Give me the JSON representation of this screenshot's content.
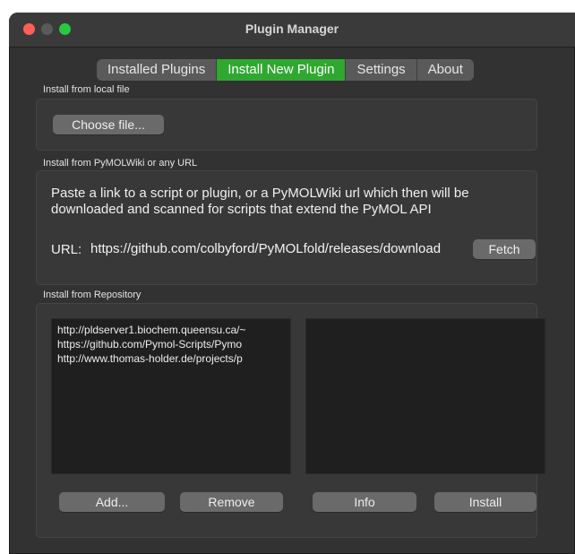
{
  "window": {
    "title": "Plugin Manager"
  },
  "tabs": [
    {
      "label": "Installed Plugins",
      "active": false
    },
    {
      "label": "Install New Plugin",
      "active": true
    },
    {
      "label": "Settings",
      "active": false
    },
    {
      "label": "About",
      "active": false
    }
  ],
  "local_file": {
    "label": "Install from local file",
    "choose_button": "Choose file..."
  },
  "url_section": {
    "label": "Install from PyMOLWiki or any URL",
    "description": "Paste a link to a script or plugin, or a PyMOLWiki url which then will be downloaded and scanned for scripts that extend the PyMOL API",
    "url_label": "URL:",
    "url_value": "https://github.com/colbyford/PyMOLfold/releases/download",
    "fetch_button": "Fetch"
  },
  "repository": {
    "label": "Install from Repository",
    "repos": [
      "http://pldserver1.biochem.queensu.ca/~",
      "https://github.com/Pymol-Scripts/Pymo",
      "http://www.thomas-holder.de/projects/p"
    ],
    "add_button": "Add...",
    "remove_button": "Remove",
    "info_button": "Info",
    "install_button": "Install"
  },
  "colors": {
    "accent_active_tab": "#2fa82f",
    "window_bg": "#323232",
    "close": "#ff5f57",
    "maximize": "#28c840"
  }
}
